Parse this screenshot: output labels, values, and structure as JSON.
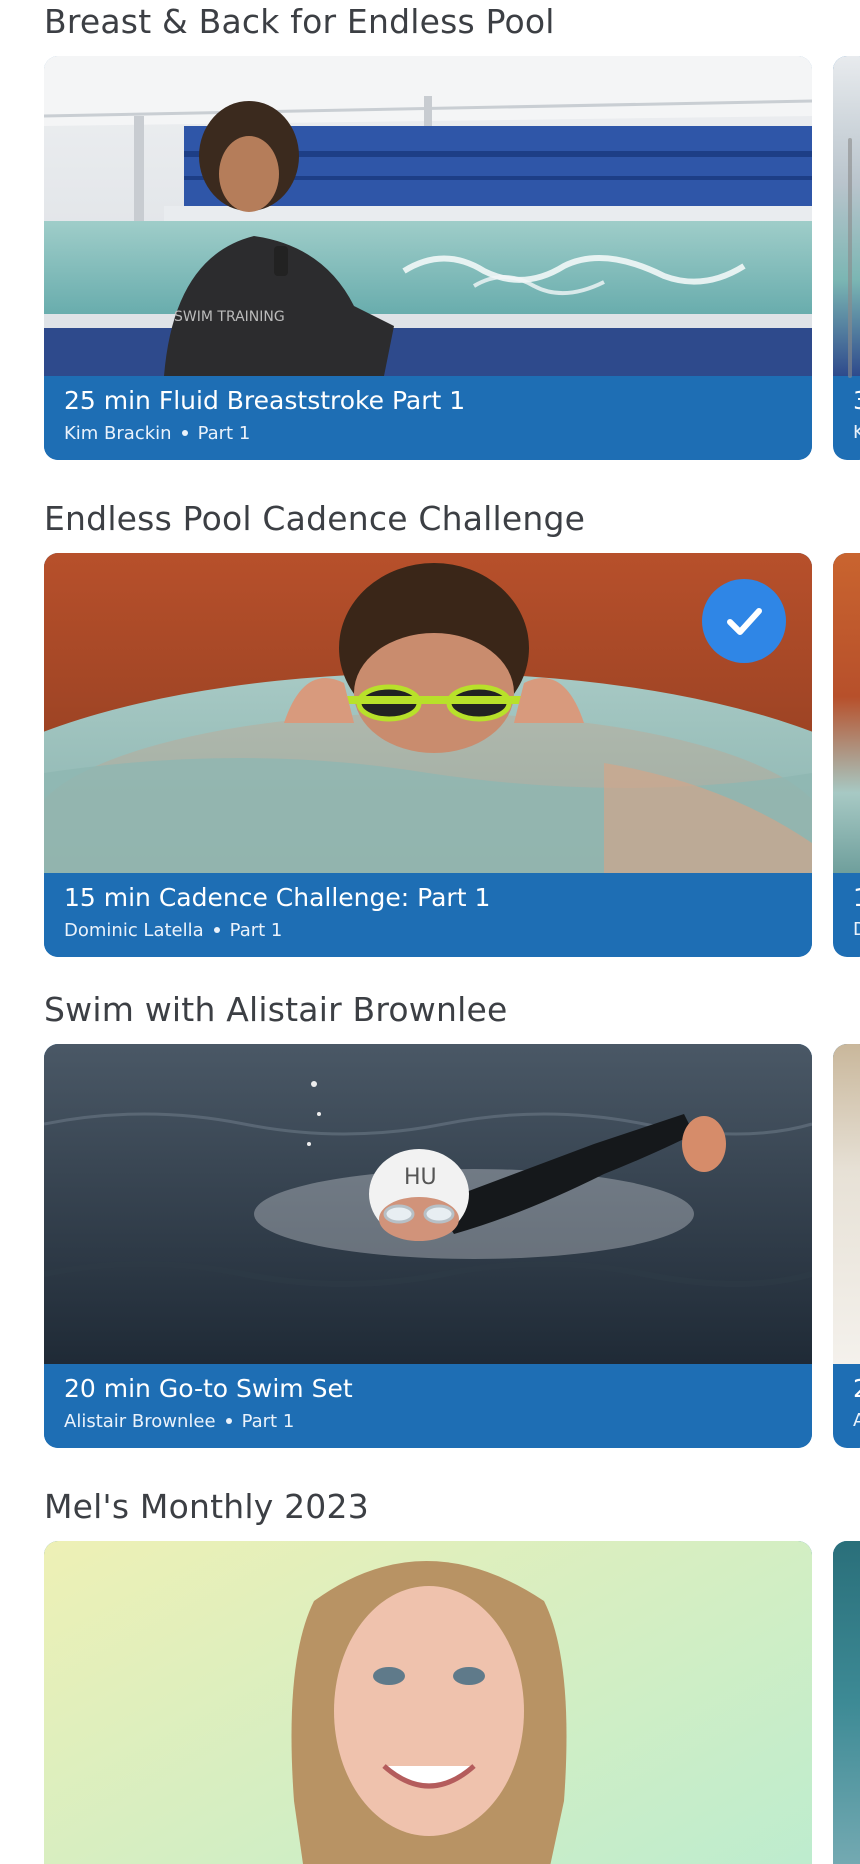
{
  "sections": [
    {
      "title": "Breast & Back for Endless Pool",
      "card": {
        "title": "25 min Fluid Breaststroke Part 1",
        "instructor": "Kim Brackin",
        "part": "Part 1",
        "completed": false
      },
      "next_card": {
        "title_peek": "3",
        "sub_peek": "K"
      }
    },
    {
      "title": "Endless Pool Cadence Challenge",
      "card": {
        "title": "15 min Cadence Challenge: Part 1",
        "instructor": "Dominic Latella",
        "part": "Part 1",
        "completed": true
      },
      "next_card": {
        "title_peek": "1",
        "sub_peek": "D"
      }
    },
    {
      "title": "Swim with Alistair Brownlee",
      "card": {
        "title": "20 min Go-to Swim Set",
        "instructor": "Alistair Brownlee",
        "part": "Part 1",
        "completed": false
      },
      "next_card": {
        "title_peek": "2",
        "sub_peek": "A"
      }
    },
    {
      "title": "Mel's Monthly 2023",
      "card": {
        "title": "",
        "instructor": "",
        "part": "",
        "completed": false
      },
      "next_card": {
        "title_peek": "",
        "sub_peek": ""
      }
    }
  ],
  "colors": {
    "card_footer": "#1e6eb4",
    "check_badge": "#2f86e6",
    "section_title": "#3c3f44"
  },
  "icons": {
    "completed": "checkmark-icon"
  }
}
